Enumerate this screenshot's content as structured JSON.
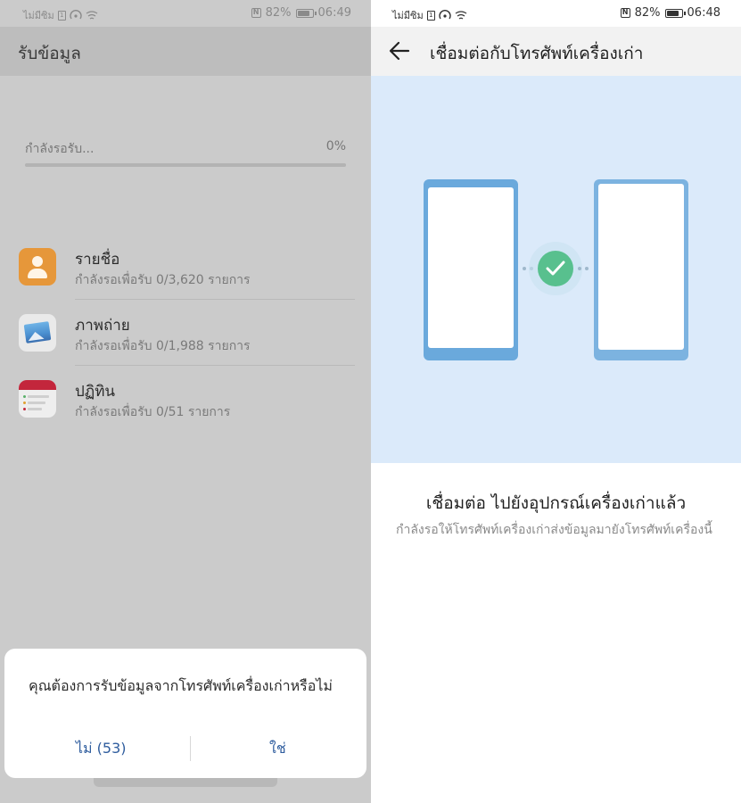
{
  "left_screen": {
    "status_bar": {
      "carrier": "ไม่มีซิม",
      "battery": "82%",
      "time": "06:49"
    },
    "title": "รับข้อมูล",
    "progress": {
      "label": "กำลังรอรับ...",
      "percent_text": "0%",
      "percent_value": 0
    },
    "items": [
      {
        "name": "รายชื่อ",
        "status": "กำลังรอเพื่อรับ 0/3,620 รายการ",
        "icon": "contacts-icon"
      },
      {
        "name": "ภาพถ่าย",
        "status": "กำลังรอเพื่อรับ 0/1,988 รายการ",
        "icon": "gallery-icon"
      },
      {
        "name": "ปฏิทิน",
        "status": "กำลังรอเพื่อรับ 0/51 รายการ",
        "icon": "calendar-icon"
      }
    ],
    "dialog": {
      "question": "คุณต้องการรับข้อมูลจากโทรศัพท์เครื่องเก่าหรือไม่",
      "no_label": "ไม่ (53)",
      "yes_label": "ใช่"
    }
  },
  "right_screen": {
    "status_bar": {
      "carrier": "ไม่มีซิม",
      "battery": "82%",
      "time": "06:48"
    },
    "title": "เชื่อมต่อกับโทรศัพท์เครื่องเก่า",
    "connected_title": "เชื่อมต่อ ไปยังอุปกรณ์เครื่องเก่าแล้ว",
    "connected_desc": "กำลังรอให้โทรศัพท์เครื่องเก่าส่งข้อมูลมายังโทรศัพท์เครื่องนี้"
  },
  "colors": {
    "accent_blue": "#2f5d9e",
    "check_green": "#58c08e",
    "hero_bg": "#dbeafa",
    "phone_blue": "#6aa9dc"
  }
}
